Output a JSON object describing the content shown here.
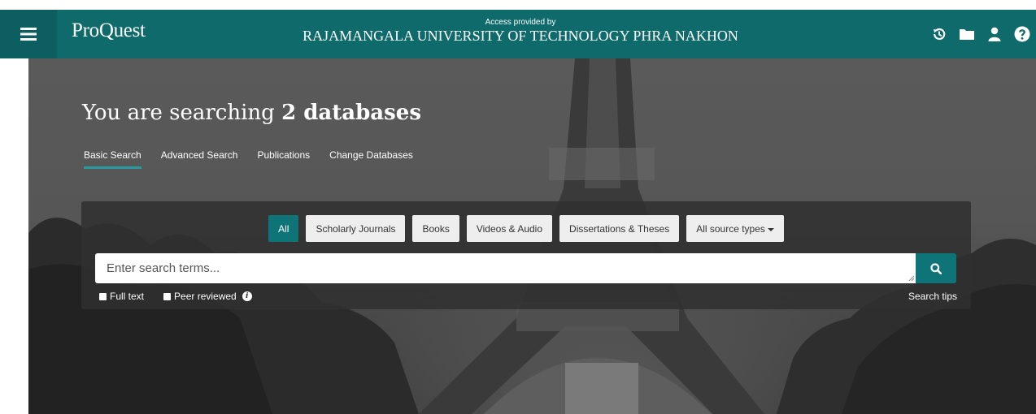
{
  "header": {
    "logo": "ProQuest",
    "access_label": "Access provided by",
    "institution": "RAJAMANGALA UNIVERSITY OF TECHNOLOGY PHRA NAKHON",
    "icons": [
      "menu-icon",
      "history-icon",
      "folder-icon",
      "user-icon",
      "help-icon"
    ],
    "bar_color": "#0f6a6c"
  },
  "hero": {
    "title_prefix": "You are searching ",
    "title_bold": "2 databases",
    "tabs": [
      {
        "label": "Basic Search",
        "active": true
      },
      {
        "label": "Advanced Search"
      },
      {
        "label": "Publications"
      },
      {
        "label": "Change Databases"
      }
    ]
  },
  "search": {
    "source_types": [
      "All",
      "Scholarly Journals",
      "Books",
      "Videos & Audio",
      "Dissertations & Theses"
    ],
    "all_sources_label": "All source types",
    "placeholder": "Enter search terms...",
    "full_text_label": "Full text",
    "peer_reviewed_label": "Peer reviewed",
    "tips_label": "Search tips",
    "accent_color": "#0f7478"
  }
}
